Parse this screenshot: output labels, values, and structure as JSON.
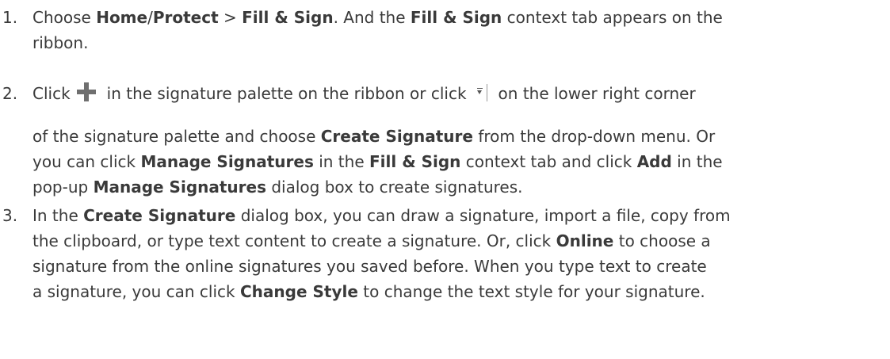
{
  "steps": [
    {
      "number": "1.",
      "lines": [
        [
          "Choose ",
          "Home",
          "/",
          "Protect",
          " > ",
          "Fill & Sign",
          ". And the ",
          "Fill & Sign",
          " context tab appears on the"
        ],
        [
          "ribbon."
        ]
      ]
    },
    {
      "number": "2.",
      "line1_before_icon": "Click",
      "line1_middle": "in the signature palette on the ribbon or click",
      "line1_end": "on the lower right corner",
      "lines": [
        [
          "of the signature palette and choose ",
          "Create Signature",
          " from the drop-down menu. Or"
        ],
        [
          "you can click ",
          "Manage Signatures",
          " in the ",
          "Fill & Sign",
          " context tab and click ",
          "Add",
          " in the"
        ],
        [
          "pop-up ",
          "Manage Signatures",
          " dialog box to create signatures."
        ]
      ],
      "icons": [
        "plus-icon",
        "dropdown-arrow-icon"
      ]
    },
    {
      "number": "3.",
      "lines": [
        [
          "In the ",
          "Create Signature",
          " dialog box, you can draw a signature, import a file, copy from"
        ],
        [
          "the clipboard, or type text content to create a signature. Or, click ",
          "Online",
          " to choose a"
        ],
        [
          "signature from the online signatures you saved before. When you type text to create"
        ],
        [
          "a signature, you can click ",
          "Change Style",
          " to change the text style for your signature."
        ]
      ]
    }
  ]
}
